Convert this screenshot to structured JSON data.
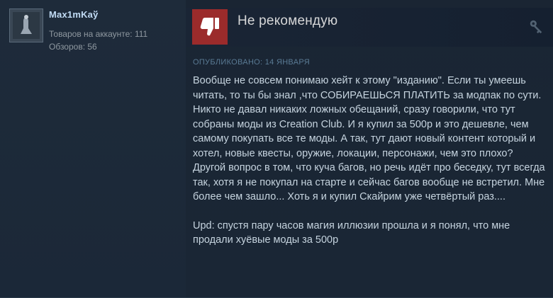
{
  "author": {
    "name": "Max1mKaў",
    "products_text": "Товаров на аккаунте: 111",
    "reviews_text": "Обзоров: 56"
  },
  "review": {
    "verdict": "Не рекомендую",
    "verdict_icon": "thumbs-down-icon",
    "award_icon": "key-icon",
    "posted": "ОПУБЛИКОВАНО: 14 ЯНВАРЯ",
    "paragraphs": [
      "Вообще не совсем понимаю хейт к этому \"изданию\". Если ты умеешь читать, то ты бы знал ,что СОБИРАЕШЬСЯ ПЛАТИТЬ за модпак по сути. Никто не давал никаких ложных обещаний, сразу говорили, что тут собраны моды из Creation Club. И я купил за 500р и это дешевле, чем самому покупать все те моды. А так, тут дают новый контент который и хотел, новые квесты, оружие, локации, персонажи, чем это плохо? Другой вопрос в том, что куча багов, но речь идёт про беседку, тут всегда так, хотя я не покупал на старте и сейчас багов вообще не встретил. Мне более чем зашло... Хоть я и купил Скайрим уже четвёртый раз....",
      "Upd: спустя пару часов магия иллюзии прошла и я понял, что мне продали хуёвые моды за 500р"
    ]
  },
  "colors": {
    "background": "#1b2838",
    "thumb_down_bg": "#9b2b2b",
    "author_name": "#c1dbf4",
    "body_text": "#c6d4df",
    "meta_text": "#8f98a0"
  }
}
